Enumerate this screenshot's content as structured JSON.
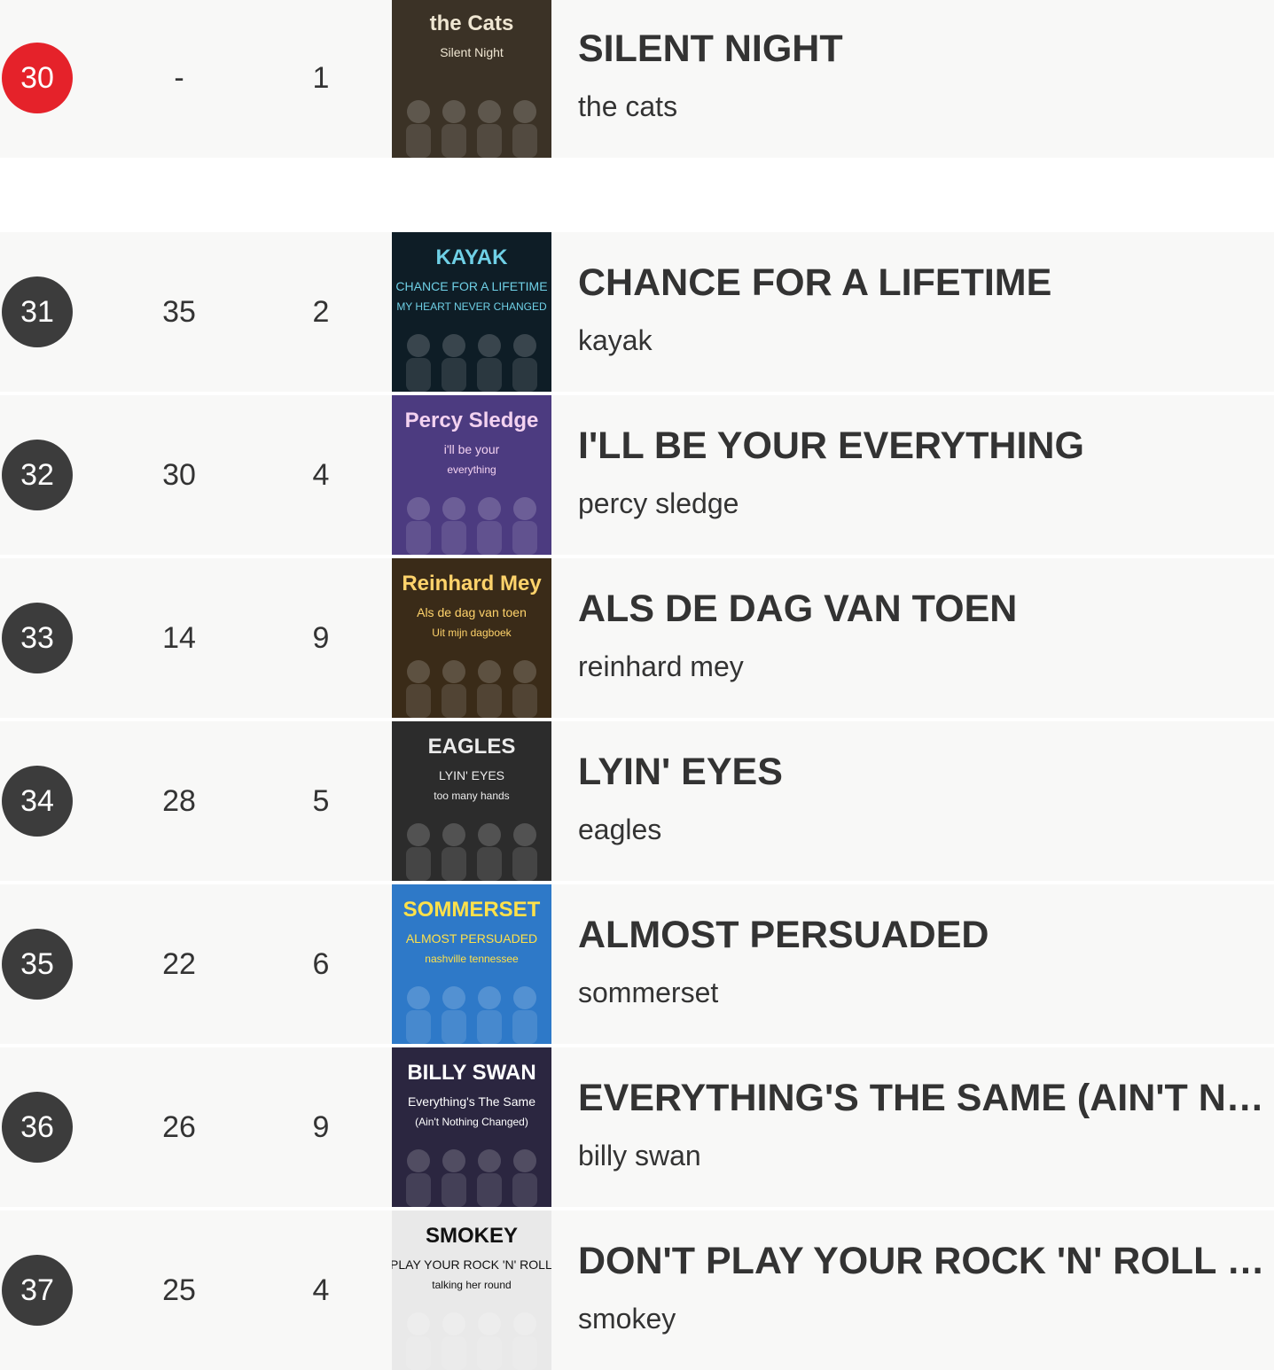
{
  "rows": [
    {
      "position": "30",
      "previous": "-",
      "weeks": "1",
      "title": "SILENT NIGHT",
      "artist": "the cats",
      "is_new": true,
      "cover": {
        "lines": [
          "the Cats",
          "Silent Night"
        ],
        "bg": "#3b3226",
        "fg": "#efe6d2"
      }
    },
    {
      "position": "31",
      "previous": "35",
      "weeks": "2",
      "title": "CHANCE FOR A LIFETIME",
      "artist": "kayak",
      "is_new": false,
      "cover": {
        "lines": [
          "KAYAK",
          "CHANCE FOR A LIFETIME",
          "MY HEART NEVER CHANGED"
        ],
        "bg": "#0e1d26",
        "fg": "#6fd0e6"
      }
    },
    {
      "position": "32",
      "previous": "30",
      "weeks": "4",
      "title": "I'LL BE YOUR EVERYTHING",
      "artist": "percy sledge",
      "is_new": false,
      "cover": {
        "lines": [
          "Percy Sledge",
          "i'll be your",
          "everything"
        ],
        "bg": "#4c3b80",
        "fg": "#f3d2f0"
      }
    },
    {
      "position": "33",
      "previous": "14",
      "weeks": "9",
      "title": "ALS DE DAG VAN TOEN",
      "artist": "reinhard mey",
      "is_new": false,
      "cover": {
        "lines": [
          "Reinhard Mey",
          "Als de dag van toen",
          "Uit mijn dagboek"
        ],
        "bg": "#3a2b18",
        "fg": "#ffd36b"
      }
    },
    {
      "position": "34",
      "previous": "28",
      "weeks": "5",
      "title": "LYIN' EYES",
      "artist": "eagles",
      "is_new": false,
      "cover": {
        "lines": [
          "EAGLES",
          "LYIN' EYES",
          "too many hands"
        ],
        "bg": "#2c2c2c",
        "fg": "#ececec"
      }
    },
    {
      "position": "35",
      "previous": "22",
      "weeks": "6",
      "title": "ALMOST PERSUADED",
      "artist": "sommerset",
      "is_new": false,
      "cover": {
        "lines": [
          "SOMMERSET",
          "ALMOST PERSUADED",
          "nashville tennessee"
        ],
        "bg": "#2e79c8",
        "fg": "#ffe14a"
      }
    },
    {
      "position": "36",
      "previous": "26",
      "weeks": "9",
      "title": "EVERYTHING'S THE SAME (AIN'T NOTHING CHANGED)",
      "artist": "billy swan",
      "is_new": false,
      "cover": {
        "lines": [
          "BILLY SWAN",
          "Everything's The Same",
          "(Ain't Nothing Changed)"
        ],
        "bg": "#2b2640",
        "fg": "#ffffff"
      }
    },
    {
      "position": "37",
      "previous": "25",
      "weeks": "4",
      "title": "DON'T PLAY YOUR ROCK 'N' ROLL TO ME",
      "artist": "smokey",
      "is_new": false,
      "cover": {
        "lines": [
          "SMOKEY",
          "DON'T PLAY YOUR ROCK 'N' ROLL TO ME",
          "talking her round"
        ],
        "bg": "#e9e9e9",
        "fg": "#111111"
      }
    }
  ]
}
